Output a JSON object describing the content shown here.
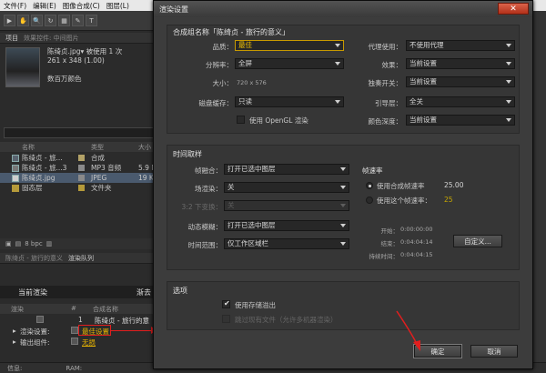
{
  "app": {
    "menu": [
      "文件(F)",
      "编辑(E)",
      "图像合成(C)",
      "图层(L)"
    ],
    "tools": [
      "▶",
      "✋",
      "🔍",
      "↻",
      "▦",
      "✎",
      "T"
    ],
    "project_tabs": [
      "项目",
      "效果控件: 中间图片"
    ],
    "thumbnail_info": {
      "name": "陈绮贞.jpg▾",
      "used": "被使用 1 次",
      "dims": "261 x 348 (1.00)",
      "colors": "数百万颜色"
    },
    "project_columns": [
      "名称",
      "类型",
      "大小"
    ],
    "project_items": [
      {
        "name": "陈绮贞 - 旅...",
        "type": "合成",
        "size": "",
        "label_color": "#b3a267"
      },
      {
        "name": "陈绮贞 - 旅...3",
        "type": "MP3 音频",
        "size": "5.9 M",
        "label_color": "#8a8a8a"
      },
      {
        "name": "陈绮贞.jpg",
        "type": "JPEG",
        "size": "19 K",
        "label_color": "#8a8a8a"
      },
      {
        "name": "固态层",
        "type": "文件夹",
        "size": "",
        "label_color": "#b59a3a"
      }
    ],
    "bpc_label": "8 bpc",
    "bottom_tabs": [
      "陈绮贞 - 旅行的意义",
      "渲染队列"
    ],
    "render_queue_title": "当前渲染",
    "render_queue_extra": "渐去",
    "rq_columns": [
      "渲染",
      "#",
      "合成名称"
    ],
    "rq_item": {
      "index": "1",
      "name": "陈绮贞 - 旅行的意"
    },
    "render_settings_label": "渲染设置:",
    "render_settings_value": "最佳设置",
    "output_module_label": "输出组件:",
    "output_module_value": "无损",
    "status": {
      "info": "信息:",
      "ram": "RAM:"
    }
  },
  "dialog": {
    "title": "渲染设置",
    "close_glyph": "✕",
    "comp_section_title": "合成组名称「陈绮贞 - 旅行的意义」",
    "quality": {
      "label": "品质：",
      "value": "最佳"
    },
    "resolution": {
      "label": "分辨率：",
      "value": "全屏"
    },
    "size": {
      "label": "大小：",
      "value": "720 x 576"
    },
    "disk_cache": {
      "label": "磁盘缓存：",
      "value": "只读"
    },
    "opengl": {
      "label": "使用 OpenGL 渲染",
      "checked": false
    },
    "proxy_use": {
      "label": "代理使用：",
      "value": "不使用代理"
    },
    "effects": {
      "label": "效果：",
      "value": "当前设置"
    },
    "solo_switch": {
      "label": "独奏开关：",
      "value": "当前设置"
    },
    "guide_layers": {
      "label": "引导层：",
      "value": "全关"
    },
    "color_depth": {
      "label": "颜色深度：",
      "value": "当前设置"
    },
    "time_section_title": "时间取样",
    "frame_blending": {
      "label": "帧融合：",
      "value": "打开已选中图层"
    },
    "field_render": {
      "label": "场渲染：",
      "value": "关"
    },
    "pulldown": {
      "label": "3:2 下变换：",
      "value": "关"
    },
    "motion_blur": {
      "label": "动态模糊：",
      "value": "打开已选中图层"
    },
    "time_span": {
      "label": "时间范围：",
      "value": "仅工作区域栏"
    },
    "frame_rate": {
      "title": "帧速率",
      "use_comp": "使用合成帧速率",
      "use_comp_value": "25.00",
      "use_this": "使用这个帧速率：",
      "use_this_value": "25"
    },
    "timing": {
      "start_label": "开始：",
      "start_value": "0:00:00:00",
      "end_label": "结束：",
      "end_value": "0:04:04:14",
      "duration_label": "持续时间：",
      "duration_value": "0:04:04:15",
      "custom_button": "自定义..."
    },
    "options_section_title": "选项",
    "use_storage_overflow": {
      "label": "使用存储溢出",
      "checked": true
    },
    "skip_existing": {
      "label": "跳过现有文件（允许多机器渲染）",
      "checked": false
    },
    "ok_button": "确定",
    "cancel_button": "取消"
  },
  "colors": {
    "highlight": "#f2c200",
    "annotation_red": "#e21e1e"
  }
}
